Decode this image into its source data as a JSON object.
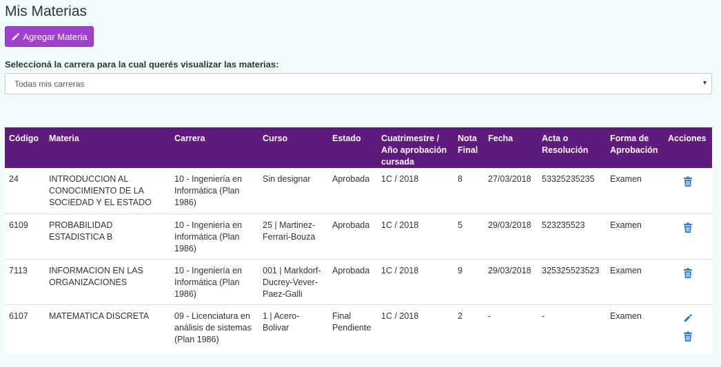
{
  "page": {
    "title": "Mis Materias"
  },
  "toolbar": {
    "add_label": "Agregar Materia"
  },
  "filter": {
    "label": "Seleccioná la carrera para la cual querés visualizar las materias:",
    "selected": "Todas mis carreras"
  },
  "table": {
    "headers": {
      "codigo": "Código",
      "materia": "Materia",
      "carrera": "Carrera",
      "curso": "Curso",
      "estado": "Estado",
      "cuatrimestre": "Cuatrimestre / Año aprobación cursada",
      "nota": "Nota Final",
      "fecha": "Fecha",
      "acta": "Acta o Resolución",
      "forma": "Forma de Aprobación",
      "acciones": "Acciones"
    },
    "rows": [
      {
        "codigo": "24",
        "materia": "INTRODUCCION AL CONOCIMIENTO DE LA SOCIEDAD Y EL ESTADO",
        "carrera": "10 - Ingeniería en Informática (Plan 1986)",
        "curso": "Sin designar",
        "estado": "Aprobada",
        "cuatrimestre": "1C / 2018",
        "nota": "8",
        "fecha": "27/03/2018",
        "acta": "53325235235",
        "forma": "Examen"
      },
      {
        "codigo": "6109",
        "materia": "PROBABILIDAD ESTADISTICA B",
        "carrera": "10 - Ingeniería en Informática (Plan 1986)",
        "curso": "25 | Martinez-Ferrari-Bouza",
        "estado": "Aprobada",
        "cuatrimestre": "1C / 2018",
        "nota": "5",
        "fecha": "29/03/2018",
        "acta": "523235523",
        "forma": "Examen"
      },
      {
        "codigo": "7113",
        "materia": "INFORMACION EN LAS ORGANIZACIONES",
        "carrera": "10 - Ingeniería en Informática (Plan 1986)",
        "curso": "001 | Markdorf-Ducrey-Vever-Paez-Galli",
        "estado": "Aprobada",
        "cuatrimestre": "1C / 2018",
        "nota": "9",
        "fecha": "29/03/2018",
        "acta": "325325523523",
        "forma": "Examen"
      },
      {
        "codigo": "6107",
        "materia": "MATEMATICA DISCRETA",
        "carrera": "09 - Licenciatura en análisis de sistemas (Plan 1986)",
        "curso": "1 | Acero-Bolivar",
        "estado": "Final Pendiente",
        "cuatrimestre": "1C / 2018",
        "nota": "2",
        "fecha": "-",
        "acta": "-",
        "forma": "Examen"
      }
    ]
  },
  "icons": {
    "add": "pencil-icon",
    "edit": "pencil-icon",
    "delete": "trash-icon",
    "dropdown": "caret-down-icon"
  },
  "colors": {
    "accent_button": "#a13fd1",
    "table_header": "#5f1a7e",
    "icon_blue": "#2a7cc7",
    "page_bg": "#f2fbfb"
  }
}
